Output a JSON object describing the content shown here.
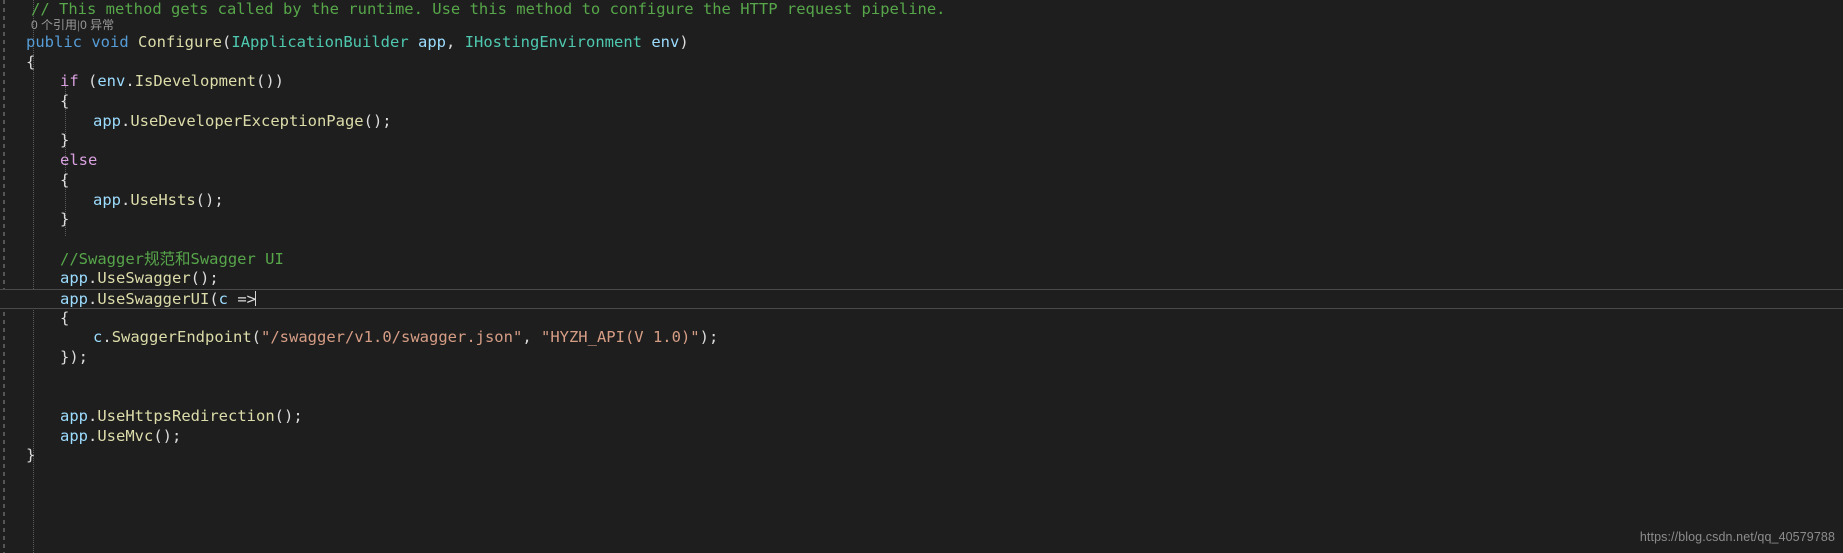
{
  "editor": {
    "theme_background": "#1e1e1e",
    "foreground": "#dcdcdc",
    "current_line_number_hint": "app.UseSwaggerUI(c =>",
    "colors": {
      "comment": "#57a64a",
      "keyword": "#569cd6",
      "control_keyword": "#d8a0df",
      "type": "#4ec9b0",
      "method": "#dcdcaa",
      "identifier": "#9cdcfe",
      "string": "#d69d85",
      "punctuation": "#dcdcdc",
      "codelens": "#999999",
      "watermark": "#8c8c8c"
    }
  },
  "codelens": {
    "references": "0 个引用",
    "separator": "|",
    "exceptions": "0 异常"
  },
  "code": {
    "l01_comment": "// This method gets called by the runtime. Use this method to configure the HTTP request pipeline.",
    "l02": {
      "kw_public": "public",
      "kw_void": "void",
      "method_name": "Configure",
      "paren_open": "(",
      "type1": "IApplicationBuilder",
      "param1": "app",
      "comma": ", ",
      "type2": "IHostingEnvironment",
      "param2": "env",
      "paren_close": ")"
    },
    "l03_open_brace": "{",
    "l04": {
      "kw_if": "if",
      "expr_open": " (",
      "ident_env": "env",
      "dot": ".",
      "method_isdev": "IsDevelopment",
      "expr_close": "())"
    },
    "l05_open_brace": "{",
    "l06": {
      "ident_app": "app",
      "dot": ".",
      "method": "UseDeveloperExceptionPage",
      "tail": "();"
    },
    "l07_close_brace": "}",
    "l08_else": "else",
    "l09_open_brace": "{",
    "l10": {
      "ident_app": "app",
      "dot": ".",
      "method": "UseHsts",
      "tail": "();"
    },
    "l11_close_brace": "}",
    "l12_blank": "",
    "l13_comment": "//Swagger规范和Swagger UI",
    "l14": {
      "ident_app": "app",
      "dot": ".",
      "method": "UseSwagger",
      "tail": "();"
    },
    "l15": {
      "ident_app": "app",
      "dot": ".",
      "method": "UseSwaggerUI",
      "paren_open": "(",
      "lambda_param": "c",
      "arrow": " =>"
    },
    "l16_open_brace": "{",
    "l17": {
      "ident_c": "c",
      "dot": ".",
      "method": "SwaggerEndpoint",
      "paren_open": "(",
      "string1": "\"/swagger/v1.0/swagger.json\"",
      "comma": ", ",
      "string2": "\"HYZH_API(V 1.0)\"",
      "tail": ");"
    },
    "l18_close": "});",
    "l19_blank": "",
    "l20_blank": "",
    "l21": {
      "ident_app": "app",
      "dot": ".",
      "method": "UseHttpsRedirection",
      "tail": "();"
    },
    "l22": {
      "ident_app": "app",
      "dot": ".",
      "method": "UseMvc",
      "tail": "();"
    },
    "l23_close_brace": "}"
  },
  "watermark": {
    "url": "https://blog.csdn.net/qq_40579788"
  }
}
